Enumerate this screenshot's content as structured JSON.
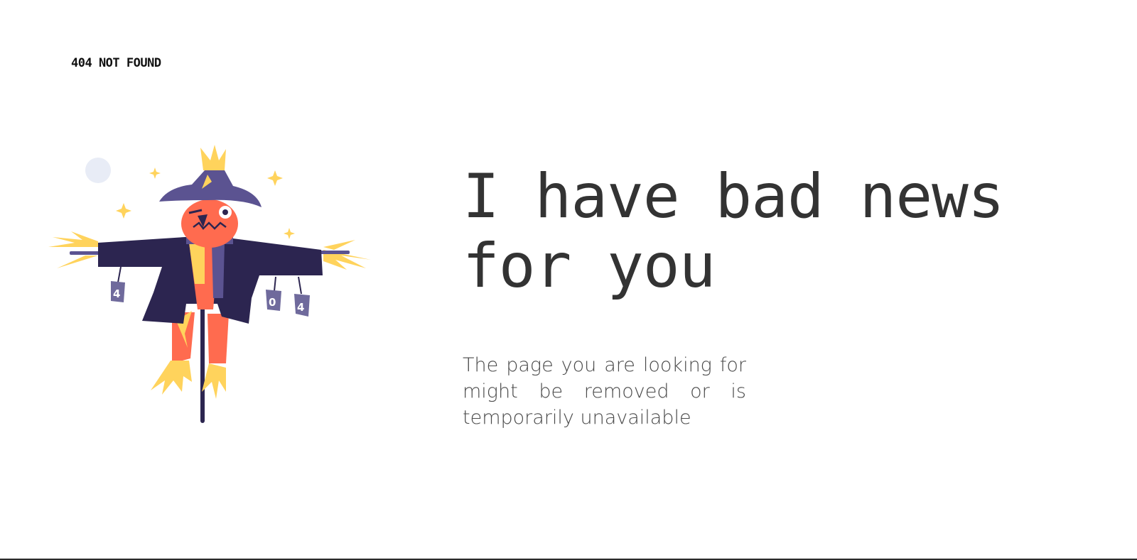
{
  "brand": {
    "label": "404 NOT FOUND"
  },
  "illustration": {
    "icon": "scarecrow-illustration",
    "cans": [
      "4",
      "0",
      "4"
    ]
  },
  "main": {
    "headline": "I have bad news for you",
    "message": "The page you are looking for might be removed or is temporarily unavailable"
  },
  "colors": {
    "text_dark": "#333333",
    "text_body": "#4a4a4a",
    "coat": "#2c2550",
    "hat": "#5b5391",
    "head": "#ff6b4f",
    "straw": "#ffd35c",
    "can": "#6f6a9c",
    "moon": "#e8ecf6"
  }
}
